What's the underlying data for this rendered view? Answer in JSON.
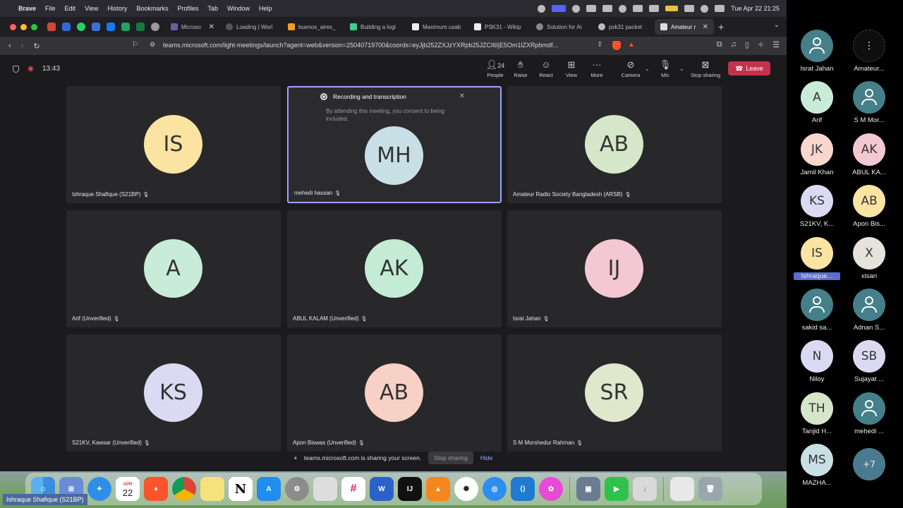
{
  "menubar": {
    "app": "Brave",
    "items": [
      "File",
      "Edit",
      "View",
      "History",
      "Bookmarks",
      "Profiles",
      "Tab",
      "Window",
      "Help"
    ],
    "clock": "Tue Apr 22  21:25"
  },
  "browser": {
    "tabs": [
      {
        "label": "Microso",
        "active": false
      },
      {
        "label": "Loading | Worl",
        "active": false
      },
      {
        "label": "buenos_aires_",
        "active": false
      },
      {
        "label": "Building a logi",
        "active": false
      },
      {
        "label": "Maximum usab",
        "active": false
      },
      {
        "label": "PSK31 - Wikip",
        "active": false
      },
      {
        "label": "Solution for Ai",
        "active": false
      },
      {
        "label": "psk31 packet",
        "active": false
      },
      {
        "label": "Amateur r",
        "active": true
      }
    ],
    "url": "teams.microsoft.com/light-meetings/launch?agent=web&version=25040719700&coords=eyJjb252ZXJzYXRpb25JZCI6IjE5Om1lZXRpbmdf..."
  },
  "meeting": {
    "timer": "13:43",
    "toolbar": {
      "people_count": "24",
      "people": "People",
      "raise": "Raise",
      "react": "React",
      "view": "View",
      "more": "More",
      "camera": "Camera",
      "mic": "Mic",
      "stop_sharing": "Stop sharing",
      "leave": "Leave"
    },
    "recording_banner": {
      "title": "Recording and transcription",
      "body": "By attending this meeting, you consent to being included."
    },
    "tiles": [
      {
        "initials": "IS",
        "name": "Ishraque Shafique (S21BP)",
        "color": "#fbe4a2",
        "speaking": false
      },
      {
        "initials": "MH",
        "name": "mehedi hassan",
        "color": "#c9dfe6",
        "speaking": true
      },
      {
        "initials": "AB",
        "name": "Amateur Radio Society Bangladesh (ARSB)",
        "color": "#d6e6c8",
        "speaking": false
      },
      {
        "initials": "A",
        "name": "Arif (Unverified)",
        "color": "#c9ecd9",
        "speaking": false
      },
      {
        "initials": "AK",
        "name": "ABUL KALAM (Unverified)",
        "color": "#c4ecd4",
        "speaking": false
      },
      {
        "initials": "IJ",
        "name": "Israt Jahan",
        "color": "#f3c8d2",
        "speaking": false
      },
      {
        "initials": "KS",
        "name": "S21KV, Kawsar (Unverified)",
        "color": "#dcdaf2",
        "speaking": false
      },
      {
        "initials": "AB",
        "name": "Apon Biswas (Unverified)",
        "color": "#f7d0c6",
        "speaking": false
      },
      {
        "initials": "SR",
        "name": "S M Morshedur Rahman",
        "color": "#dfe8cc",
        "speaking": false
      }
    ],
    "share_bar": {
      "text": "teams.microsoft.com is sharing your screen.",
      "stop": "Stop sharing",
      "hide": "Hide"
    }
  },
  "dock": {
    "calendar_month": "APR",
    "calendar_day": "22",
    "tooltip": "Ishraque Shafique (S21BP)"
  },
  "participants_panel": [
    {
      "initials": "",
      "name": "Israt Jahan",
      "type": "person"
    },
    {
      "initials": "⋮",
      "name": "Amateur...",
      "type": "dark"
    },
    {
      "initials": "A",
      "name": "Arif",
      "type": "initials",
      "color": "#c9ecd9"
    },
    {
      "initials": "",
      "name": "S M Mor...",
      "type": "person"
    },
    {
      "initials": "JK",
      "name": "Jamil Khan",
      "type": "initials",
      "color": "#f8d7cf"
    },
    {
      "initials": "AK",
      "name": "ABUL KA...",
      "type": "initials",
      "color": "#f3c8d2"
    },
    {
      "initials": "KS",
      "name": "S21KV, K...",
      "type": "initials",
      "color": "#dcdaf2"
    },
    {
      "initials": "AB",
      "name": "Apon Bis...",
      "type": "initials",
      "color": "#fbe4a2"
    },
    {
      "initials": "IS",
      "name": "Ishraque...",
      "type": "initials",
      "color": "#fbe4a2",
      "highlight": true
    },
    {
      "initials": "X",
      "name": "xisan",
      "type": "initials",
      "color": "#e6e2dc"
    },
    {
      "initials": "",
      "name": "sakid sa...",
      "type": "person"
    },
    {
      "initials": "",
      "name": "Adnan S...",
      "type": "person"
    },
    {
      "initials": "N",
      "name": "Niloy",
      "type": "initials",
      "color": "#dcdaf2"
    },
    {
      "initials": "SB",
      "name": "Sujayat ...",
      "type": "initials",
      "color": "#dcdaf2"
    },
    {
      "initials": "TH",
      "name": "Tanjid H...",
      "type": "initials",
      "color": "#d6e6c8"
    },
    {
      "initials": "",
      "name": "mehedi ...",
      "type": "person"
    },
    {
      "initials": "MS",
      "name": "MAZHA...",
      "type": "initials",
      "color": "#c9dfe6"
    },
    {
      "initials": "+7",
      "name": "",
      "type": "more"
    }
  ]
}
